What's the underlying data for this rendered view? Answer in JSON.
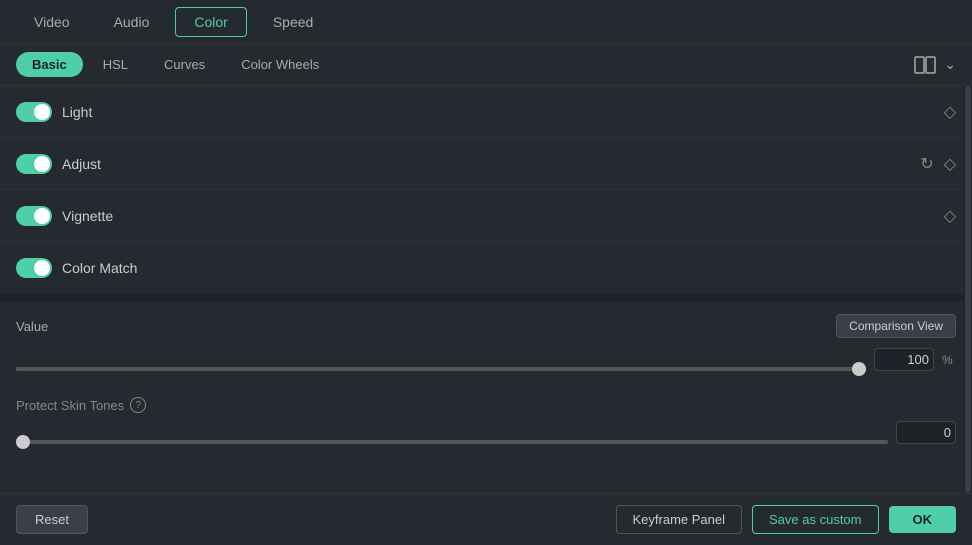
{
  "topTabs": {
    "items": [
      {
        "label": "Video",
        "active": false
      },
      {
        "label": "Audio",
        "active": false
      },
      {
        "label": "Color",
        "active": true
      },
      {
        "label": "Speed",
        "active": false
      }
    ]
  },
  "subTabs": {
    "items": [
      {
        "label": "Basic",
        "active": true
      },
      {
        "label": "HSL",
        "active": false
      },
      {
        "label": "Curves",
        "active": false
      },
      {
        "label": "Color Wheels",
        "active": false
      }
    ]
  },
  "sections": [
    {
      "id": "light",
      "label": "Light",
      "enabled": true,
      "hasReset": false,
      "hasDiamond": true
    },
    {
      "id": "adjust",
      "label": "Adjust",
      "enabled": true,
      "hasReset": true,
      "hasDiamond": true
    },
    {
      "id": "vignette",
      "label": "Vignette",
      "enabled": true,
      "hasReset": false,
      "hasDiamond": true
    },
    {
      "id": "color-match",
      "label": "Color Match",
      "enabled": true,
      "hasReset": false,
      "hasDiamond": false
    }
  ],
  "valueSlider": {
    "label": "Value",
    "value": 100,
    "percent": "%",
    "comparisonLabel": "Comparison View",
    "percent_position": 97
  },
  "protectSkinTones": {
    "label": "Protect Skin Tones",
    "helpTooltip": "?",
    "value": 0,
    "percent_position": 0
  },
  "bottomBar": {
    "resetLabel": "Reset",
    "keyframeLabel": "Keyframe Panel",
    "saveCustomLabel": "Save as custom",
    "okLabel": "OK"
  }
}
